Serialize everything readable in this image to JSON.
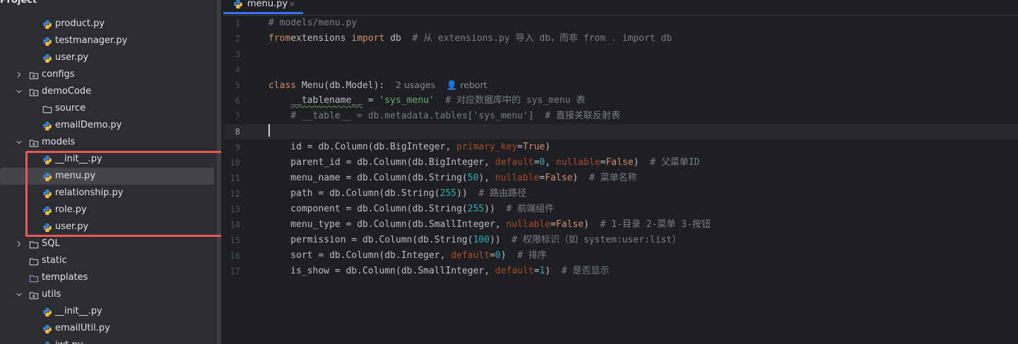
{
  "project": {
    "title": "Project",
    "items": [
      {
        "label": "product.py",
        "type": "py",
        "depth": 2
      },
      {
        "label": "testmanager.py",
        "type": "py",
        "depth": 2
      },
      {
        "label": "user.py",
        "type": "py",
        "depth": 2
      },
      {
        "label": "configs",
        "type": "dir",
        "depth": 1,
        "expanded": false
      },
      {
        "label": "demoCode",
        "type": "dir",
        "depth": 1,
        "expanded": true
      },
      {
        "label": "source",
        "type": "folder",
        "depth": 2
      },
      {
        "label": "emailDemo.py",
        "type": "py",
        "depth": 2
      },
      {
        "label": "models",
        "type": "dir",
        "depth": 1,
        "expanded": true
      },
      {
        "label": "__init__.py",
        "type": "py",
        "depth": 2
      },
      {
        "label": "menu.py",
        "type": "py",
        "depth": 2,
        "selected": true
      },
      {
        "label": "relationship.py",
        "type": "py",
        "depth": 2
      },
      {
        "label": "role.py",
        "type": "py",
        "depth": 2
      },
      {
        "label": "user.py",
        "type": "py",
        "depth": 2
      },
      {
        "label": "SQL",
        "type": "folder",
        "depth": 1,
        "expanded": false
      },
      {
        "label": "static",
        "type": "folder",
        "depth": 1
      },
      {
        "label": "templates",
        "type": "template",
        "depth": 1
      },
      {
        "label": "utils",
        "type": "dir",
        "depth": 1,
        "expanded": true
      },
      {
        "label": "__init__.py",
        "type": "py",
        "depth": 2
      },
      {
        "label": "emailUtil.py",
        "type": "py",
        "depth": 2
      },
      {
        "label": "jwt.py",
        "type": "py",
        "depth": 2
      }
    ]
  },
  "editor": {
    "tab": {
      "label": "menu.py",
      "close": "×"
    },
    "current_line": 8,
    "lines": [
      {
        "n": "1",
        "tokens": [
          [
            "cm",
            "# models/menu.py"
          ]
        ]
      },
      {
        "n": "2",
        "tokens": [
          [
            "kw",
            "from"
          ],
          [
            "",
            "extensions "
          ],
          [
            "kw",
            "import"
          ],
          [
            "",
            " db  "
          ],
          [
            "cm",
            "# 从 extensions.py 导入 db，而非 from . import db"
          ]
        ]
      },
      {
        "n": "3",
        "tokens": []
      },
      {
        "n": "4",
        "tokens": []
      },
      {
        "n": "5",
        "tokens": [
          [
            "kw",
            "class"
          ],
          [
            "",
            " Menu(db.Model):  "
          ],
          [
            "hint",
            "2 usages"
          ],
          [
            "",
            "  "
          ],
          [
            "hint",
            "👤 rebort"
          ]
        ]
      },
      {
        "n": "6",
        "tokens": [
          [
            "",
            "    "
          ],
          [
            "dunder",
            "__tablename__"
          ],
          [
            "",
            " = "
          ],
          [
            "str",
            "'sys_menu'"
          ],
          [
            "",
            "  "
          ],
          [
            "cm",
            "# 对应数据库中的 sys_menu 表"
          ]
        ]
      },
      {
        "n": "7",
        "tokens": [
          [
            "",
            "    "
          ],
          [
            "cm",
            "# __table__ = db.metadata.tables['sys_menu']  # 直接关联反射表"
          ]
        ]
      },
      {
        "n": "8",
        "tokens": []
      },
      {
        "n": "9",
        "tokens": [
          [
            "",
            "    id = db.Column(db.BigInteger, "
          ],
          [
            "kwarg",
            "primary_key"
          ],
          [
            "",
            "="
          ],
          [
            "kw",
            "True"
          ],
          [
            "",
            ")"
          ]
        ]
      },
      {
        "n": "10",
        "tokens": [
          [
            "",
            "    parent_id = db.Column(db.BigInteger, "
          ],
          [
            "kwarg",
            "default"
          ],
          [
            "",
            "="
          ],
          [
            "num",
            "0"
          ],
          [
            "",
            ", "
          ],
          [
            "kwarg",
            "nullable"
          ],
          [
            "",
            "="
          ],
          [
            "kw",
            "False"
          ],
          [
            "",
            ")  "
          ],
          [
            "cm",
            "# 父菜单ID"
          ]
        ]
      },
      {
        "n": "11",
        "tokens": [
          [
            "",
            "    menu_name = db.Column(db.String("
          ],
          [
            "num",
            "50"
          ],
          [
            "",
            "), "
          ],
          [
            "kwarg",
            "nullable"
          ],
          [
            "",
            "="
          ],
          [
            "kw",
            "False"
          ],
          [
            "",
            ")  "
          ],
          [
            "cm",
            "# 菜单名称"
          ]
        ]
      },
      {
        "n": "12",
        "tokens": [
          [
            "",
            "    path = db.Column(db.String("
          ],
          [
            "num",
            "255"
          ],
          [
            "",
            "))  "
          ],
          [
            "cm",
            "# 路由路径"
          ]
        ]
      },
      {
        "n": "13",
        "tokens": [
          [
            "",
            "    component = db.Column(db.String("
          ],
          [
            "num",
            "255"
          ],
          [
            "",
            "))  "
          ],
          [
            "cm",
            "# 前端组件"
          ]
        ]
      },
      {
        "n": "14",
        "tokens": [
          [
            "",
            "    menu_type = db.Column(db.SmallInteger, "
          ],
          [
            "kwarg",
            "nullable"
          ],
          [
            "",
            "="
          ],
          [
            "kw",
            "False"
          ],
          [
            "",
            ")  "
          ],
          [
            "cm",
            "# 1-目录 2-菜单 3-按钮"
          ]
        ]
      },
      {
        "n": "15",
        "tokens": [
          [
            "",
            "    permission = db.Column(db.String("
          ],
          [
            "num",
            "100"
          ],
          [
            "",
            "))  "
          ],
          [
            "cm",
            "# 权限标识（如 system:user:list）"
          ]
        ]
      },
      {
        "n": "16",
        "tokens": [
          [
            "",
            "    sort = db.Column(db.Integer, "
          ],
          [
            "kwarg",
            "default"
          ],
          [
            "",
            "="
          ],
          [
            "num",
            "0"
          ],
          [
            "",
            ")  "
          ],
          [
            "cm",
            "# 排序"
          ]
        ]
      },
      {
        "n": "17",
        "tokens": [
          [
            "",
            "    is_show = db.Column(db.SmallInteger, "
          ],
          [
            "kwarg",
            "default"
          ],
          [
            "",
            "="
          ],
          [
            "num",
            "1"
          ],
          [
            "",
            ")  "
          ],
          [
            "cm",
            "# 是否显示"
          ]
        ]
      }
    ]
  },
  "colors": {
    "accent": "#3574f0",
    "highlight_box": "#e8575a",
    "selection": "#43454a"
  }
}
